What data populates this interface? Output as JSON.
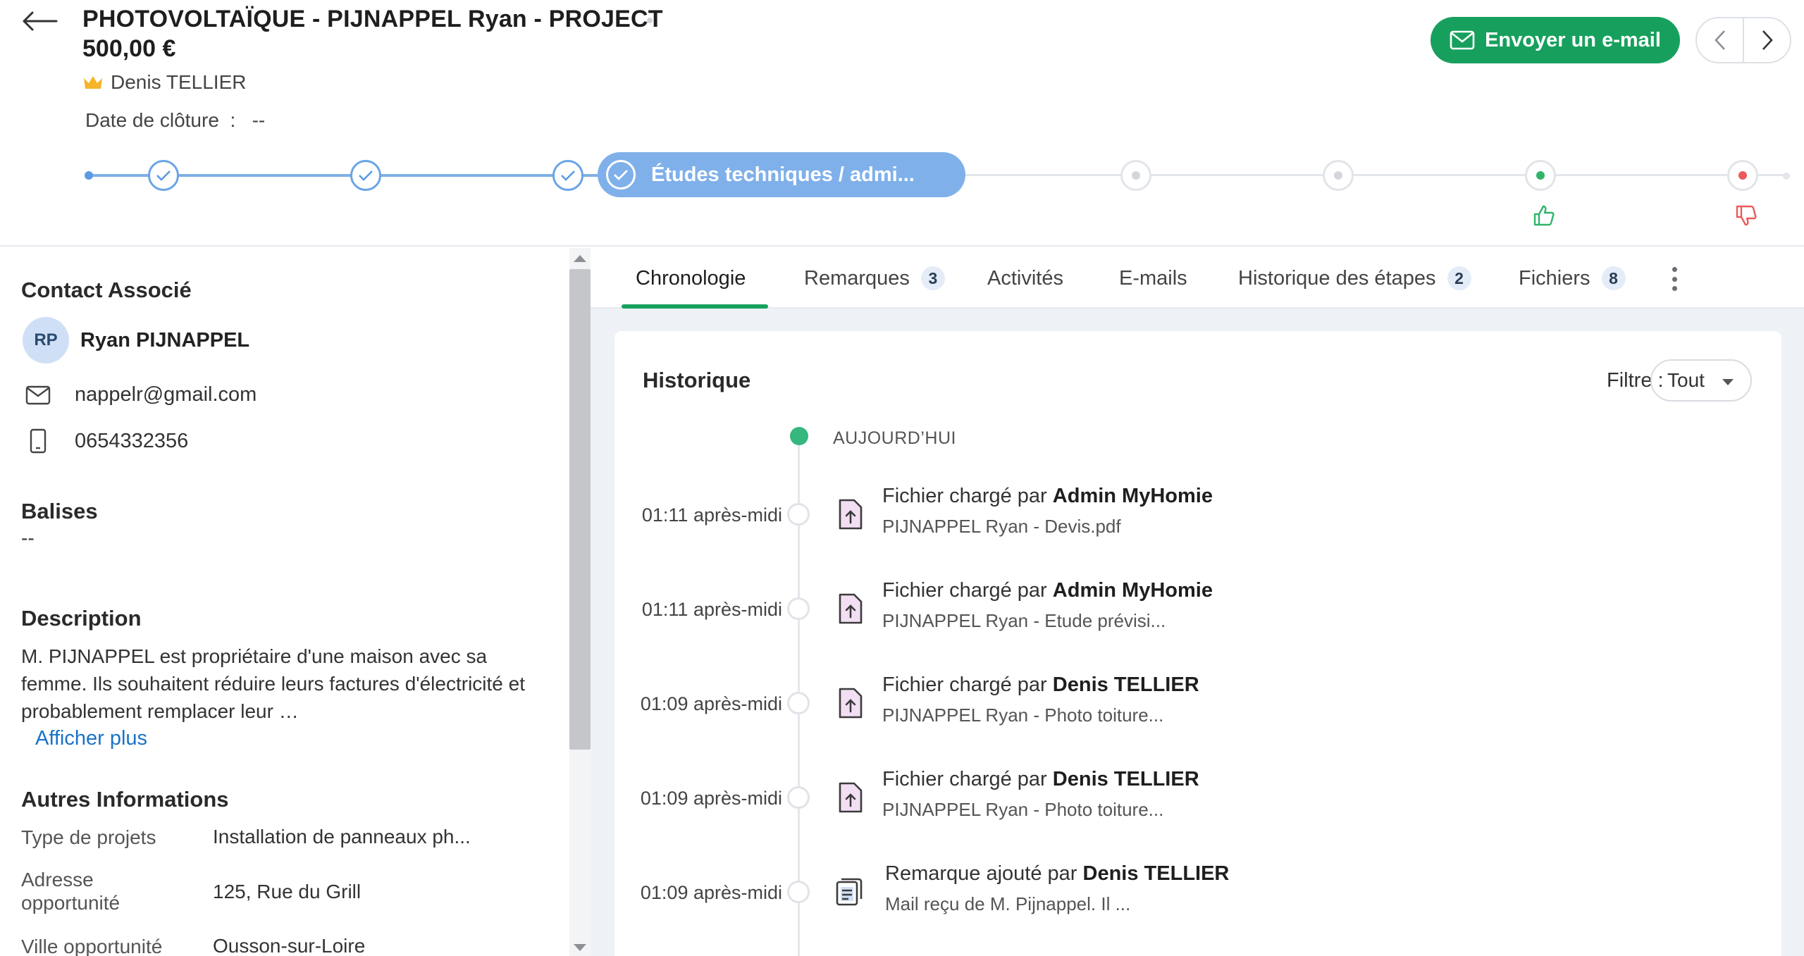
{
  "header": {
    "title": "PHOTOVOLTAÏQUE - PIJNAPPEL Ryan - PROJECT",
    "amount": "500,00 €",
    "owner": "Denis TELLIER",
    "close_date_label": "Date de clôture",
    "close_date_value": "--",
    "email_button": "Envoyer un e-mail"
  },
  "stages": {
    "current_label": "Études techniques / admi..."
  },
  "left": {
    "contact_title": "Contact Associé",
    "contact_initials": "RP",
    "contact_name": "Ryan PIJNAPPEL",
    "email": "nappelr@gmail.com",
    "phone": "0654332356",
    "tags_title": "Balises",
    "tags_value": "--",
    "description_title": "Description",
    "description_text": "M. PIJNAPPEL est propriétaire d'une maison avec sa femme. Ils souhaitent réduire leurs factures d'électricité et probablement remplacer leur …",
    "show_more": "Afficher plus",
    "other_title": "Autres Informations",
    "fields": [
      {
        "key": "Type de projets",
        "value": "Installation de panneaux ph..."
      },
      {
        "key": "Adresse opportunité",
        "value": "125, Rue du Grill"
      },
      {
        "key": "Ville opportunité",
        "value": "Ousson-sur-Loire"
      }
    ]
  },
  "tabs": [
    {
      "label": "Chronologie"
    },
    {
      "label": "Remarques",
      "badge": "3"
    },
    {
      "label": "Activités"
    },
    {
      "label": "E-mails"
    },
    {
      "label": "Historique des étapes",
      "badge": "2"
    },
    {
      "label": "Fichiers",
      "badge": "8"
    }
  ],
  "history": {
    "title": "Historique",
    "filter_label": "Filtre :",
    "filter_value": "Tout",
    "today_label": "AUJOURD’HUI",
    "items": [
      {
        "time": "01:11 après-midi",
        "action": "Fichier chargé par",
        "actor": "Admin MyHomie",
        "detail": "PIJNAPPEL Ryan - Devis.pdf",
        "icon": "file-upload-icon"
      },
      {
        "time": "01:11 après-midi",
        "action": "Fichier chargé par",
        "actor": "Admin MyHomie",
        "detail": "PIJNAPPEL Ryan - Etude prévisi...",
        "icon": "file-upload-icon"
      },
      {
        "time": "01:09 après-midi",
        "action": "Fichier chargé par",
        "actor": "Denis TELLIER",
        "detail": "PIJNAPPEL Ryan - Photo toiture...",
        "icon": "file-upload-icon"
      },
      {
        "time": "01:09 après-midi",
        "action": "Fichier chargé par",
        "actor": "Denis TELLIER",
        "detail": "PIJNAPPEL Ryan - Photo toiture...",
        "icon": "file-upload-icon"
      },
      {
        "time": "01:09 après-midi",
        "action": "Remarque ajouté par",
        "actor": "Denis TELLIER",
        "detail": "Mail reçu de M. Pijnappel. Il ...",
        "icon": "note-icon"
      }
    ]
  },
  "colors": {
    "primary_green": "#17a05d",
    "stage_blue": "#7fb0ea",
    "link_blue": "#1a73c9",
    "won_green": "#2fb56a",
    "lost_red": "#ec5a5a"
  }
}
